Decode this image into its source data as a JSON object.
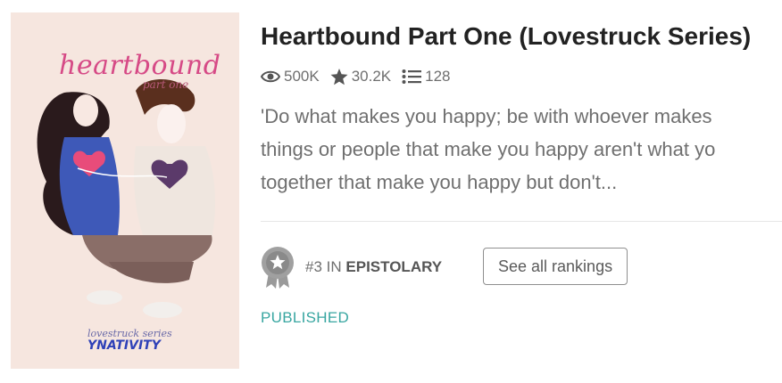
{
  "cover": {
    "title_script": "heartbound",
    "subtitle_script": "part one",
    "series_script": "lovestruck series",
    "author_script": "YNATIVITY",
    "background": "#f6e6df"
  },
  "book": {
    "title": "Heartbound Part One (Lovestruck Series)",
    "stats": {
      "reads": "500K",
      "votes": "30.2K",
      "parts": "128",
      "reads_icon": "eye-icon",
      "votes_icon": "star-icon",
      "parts_icon": "list-icon"
    },
    "description_lines": [
      "'Do what makes you happy; be with whoever makes",
      "things or people that make you happy aren't what yo",
      "together that make you happy but don't..."
    ]
  },
  "ranking": {
    "hash": "#3",
    "in": "IN",
    "category": "EPISTOLARY",
    "badge_icon": "star-badge-icon",
    "button_label": "See all rankings"
  },
  "status": "PUBLISHED",
  "colors": {
    "status": "#38a6a1",
    "text_muted": "#6f6f6f",
    "title": "#222222"
  }
}
